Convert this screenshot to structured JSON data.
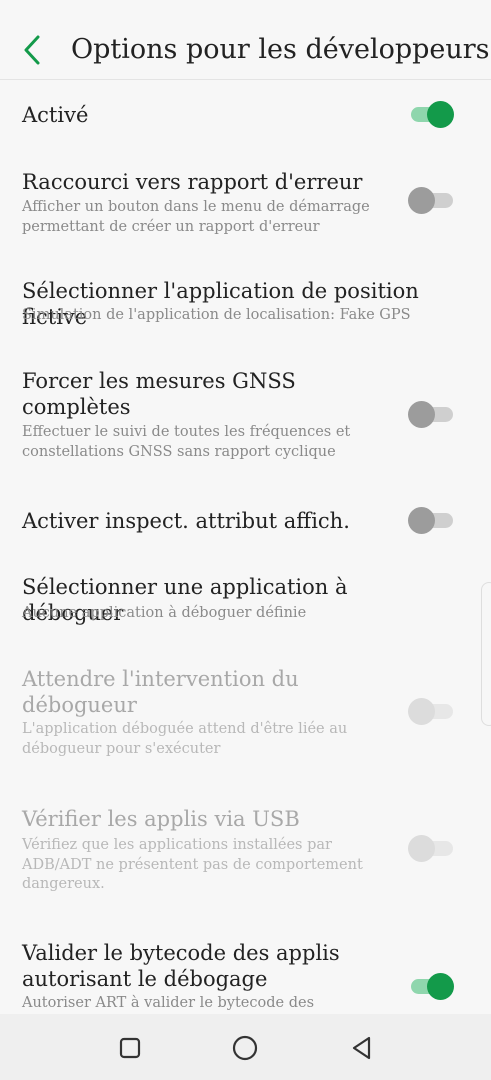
{
  "header": {
    "title": "Options pour les développeurs",
    "back_icon": "arrow-back-icon"
  },
  "colors": {
    "accent": "#139a4a",
    "accent_track": "#8fd6ad"
  },
  "items": [
    {
      "title": "Activé",
      "subtitle": "",
      "switch": "on"
    },
    {
      "title": "Raccourci vers rapport d'erreur",
      "subtitle": "Afficher un bouton dans le menu de démarrage permettant de créer un rapport d'erreur",
      "switch": "off"
    },
    {
      "title": "Sélectionner l'application de position fictive",
      "subtitle": "Simulation de l'application de localisation: Fake GPS",
      "switch": "none"
    },
    {
      "title": "Forcer les mesures GNSS complètes",
      "subtitle": "Effectuer le suivi de toutes les fréquences et constellations GNSS sans rapport cyclique",
      "switch": "off"
    },
    {
      "title": "Activer inspect. attribut affich.",
      "subtitle": "",
      "switch": "off"
    },
    {
      "title": "Sélectionner une application à déboguer",
      "subtitle": "Aucune application à déboguer définie",
      "switch": "none"
    },
    {
      "title": "Attendre l'intervention du débogueur",
      "subtitle": "L'application déboguée attend d'être liée au débogueur pour s'exécuter",
      "switch": "disabled-off"
    },
    {
      "title": "Vérifier les applis via USB",
      "subtitle": "Vérifiez que les applications installées par ADB/ADT ne présentent pas de comportement dangereux.",
      "switch": "disabled-off"
    },
    {
      "title": "Valider le bytecode des applis autorisant le débogage",
      "subtitle": "Autoriser ART à valider le bytecode des",
      "switch": "on"
    }
  ],
  "navbar": {
    "recents_icon": "square-recents-icon",
    "home_icon": "circle-home-icon",
    "back_icon": "triangle-back-icon"
  }
}
